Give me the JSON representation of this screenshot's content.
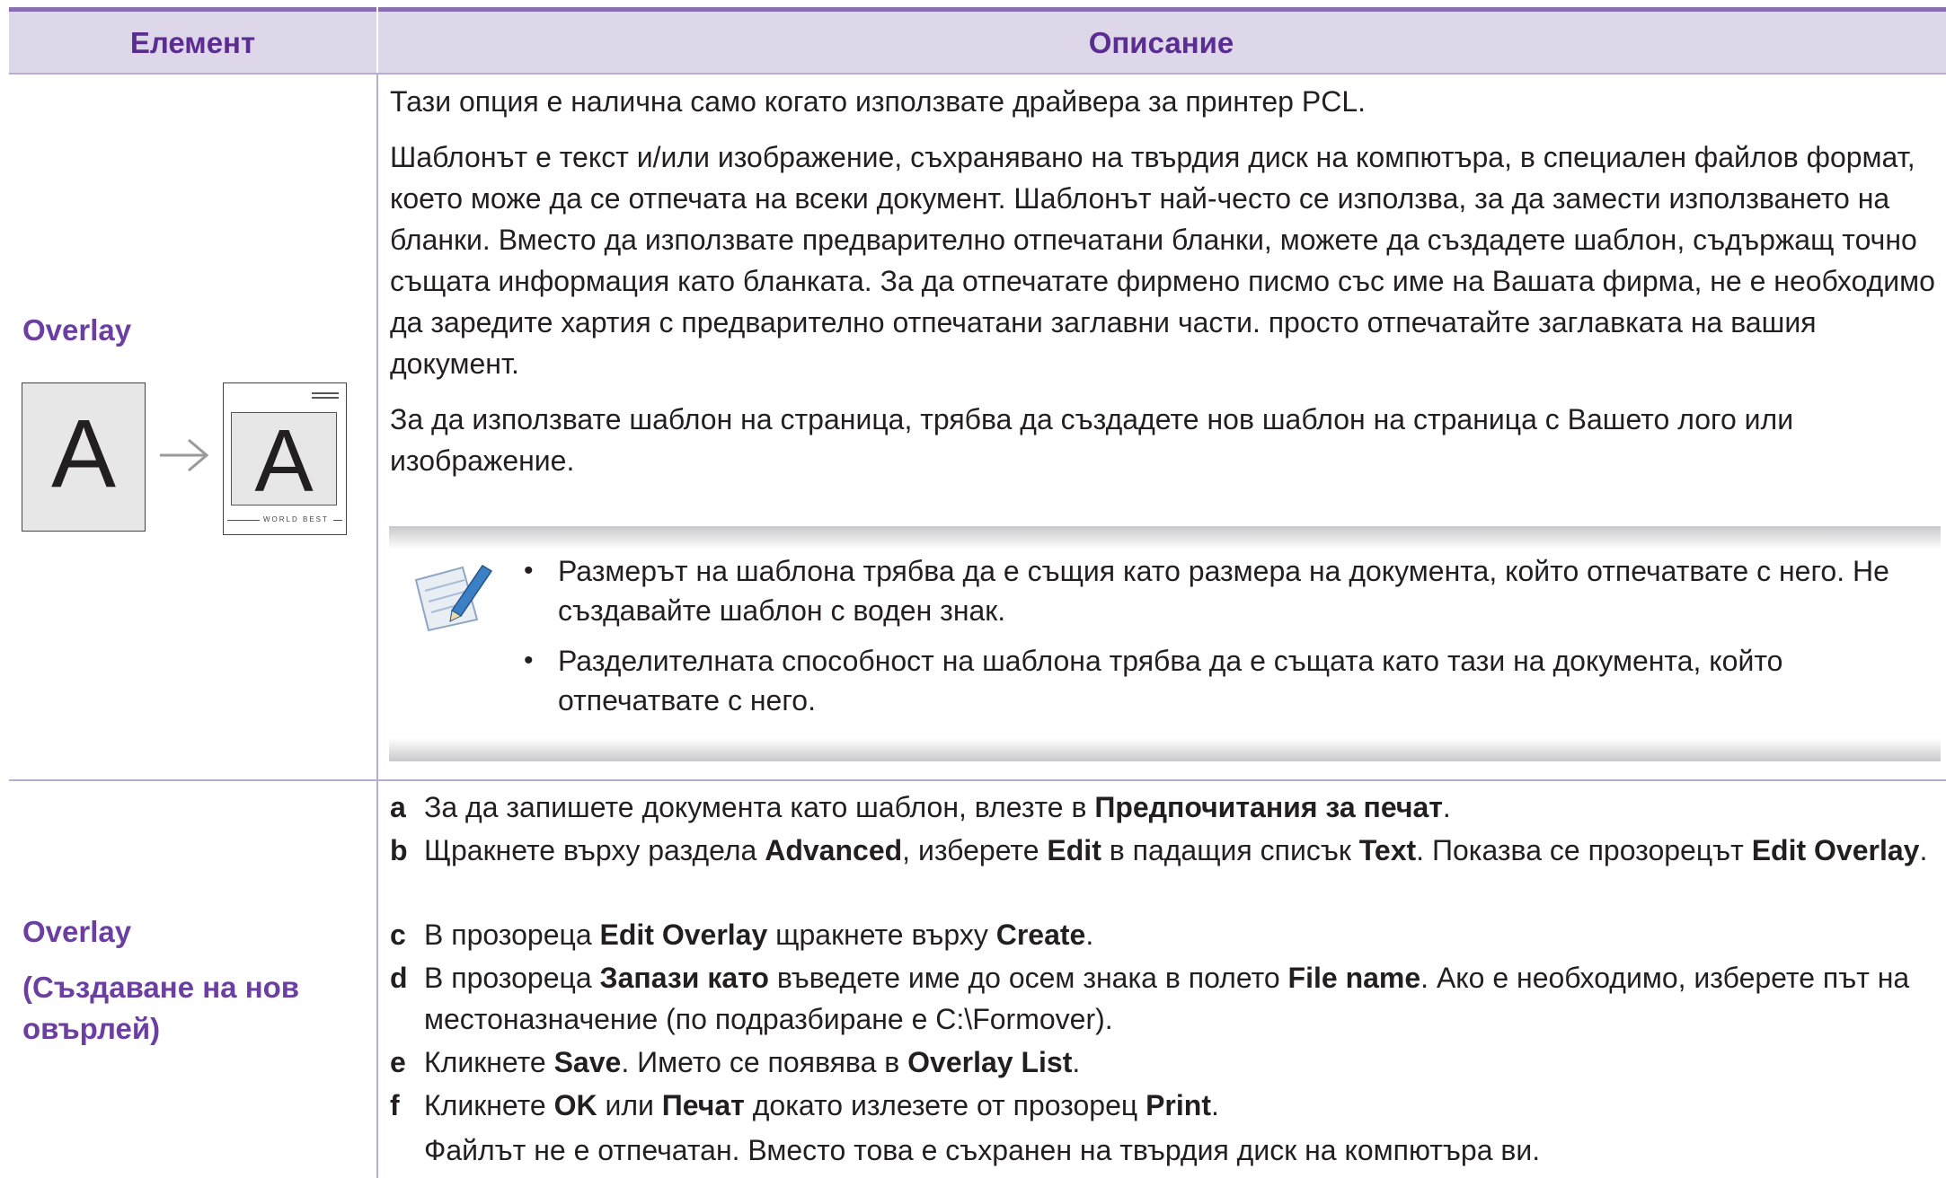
{
  "header": {
    "col_element": "Елемент",
    "col_description": "Описание"
  },
  "row1": {
    "label": "Overlay",
    "illustration": {
      "page_letter": "A",
      "overlay_letter": "A",
      "watermark_text": "WORLD BEST"
    },
    "paragraphs": [
      "Тази опция е налична само когато използвате драйвера за принтер PCL.",
      "Шаблонът е текст и/или изображение, съхранявано на твърдия диск на компютъра, в специален файлов формат, което може да се отпечата на всеки документ. Шаблонът най-често се използва, за да замести използването на бланки. Вместо да използвате предварително отпечатани бланки, можете да създадете шаблон, съдържащ точно същата информация като бланката. За да отпечатате фирмено писмо със име на Вашата фирма, не е необходимо да заредите хартия с предварително отпечатани заглавни части. просто отпечатайте заглавката на вашия документ.",
      "За да използвате шаблон на страница, трябва да създадете нов шаблон на страница с Вашето лого или изображение."
    ],
    "note": {
      "icon": "note-pencil-icon",
      "bullets": [
        "Размерът на шаблона трябва да е същия като размера на документа, който отпечатвате с него. Не създавайте шаблон с воден знак.",
        "Разделителната способност на шаблона трябва да е същата като тази на документа, който отпечатвате с него."
      ]
    }
  },
  "row2": {
    "label": "Overlay",
    "sublabel_line1": "(Създаване на нов",
    "sublabel_line2": "овърлей)",
    "steps": [
      {
        "letter": "a",
        "parts": [
          "За да запишете документа като шаблон, влезте в ",
          "Предпочитания за печат",
          "."
        ]
      },
      {
        "letter": "b",
        "parts": [
          "Щракнете върху раздела ",
          "Advanced",
          ", изберете ",
          "Edit",
          " в падащия списък ",
          "Text",
          ". Показва се прозорецът ",
          "Edit Overlay",
          "."
        ]
      },
      {
        "letter": "c",
        "parts": [
          "В прозореца ",
          "Edit Overlay",
          " щракнете върху ",
          "Create",
          "."
        ]
      },
      {
        "letter": "d",
        "parts": [
          "В прозореца ",
          "Запази като",
          " въведете име до осем знака в полето ",
          "File name",
          ". Ако е необходимо, изберете път на местоназначение (по подразбиране е C:\\Formover)."
        ]
      },
      {
        "letter": "e",
        "parts": [
          "Кликнете ",
          "Save",
          ". Името се появява в ",
          "Overlay List",
          "."
        ]
      },
      {
        "letter": "f",
        "parts": [
          "Кликнете ",
          "OK",
          " или ",
          "Печат",
          " докато излезете от прозорец ",
          "Print",
          "."
        ]
      }
    ],
    "final_note": "Файлът не е отпечатан. Вместо това е съхранен на твърдия диск на компютъра ви."
  },
  "colors": {
    "header_bg": "#ded7ea",
    "header_border": "#8a6fb0",
    "accent_text": "#5b2d91",
    "label_text": "#6b3fa0",
    "grid": "#b8acd0"
  }
}
